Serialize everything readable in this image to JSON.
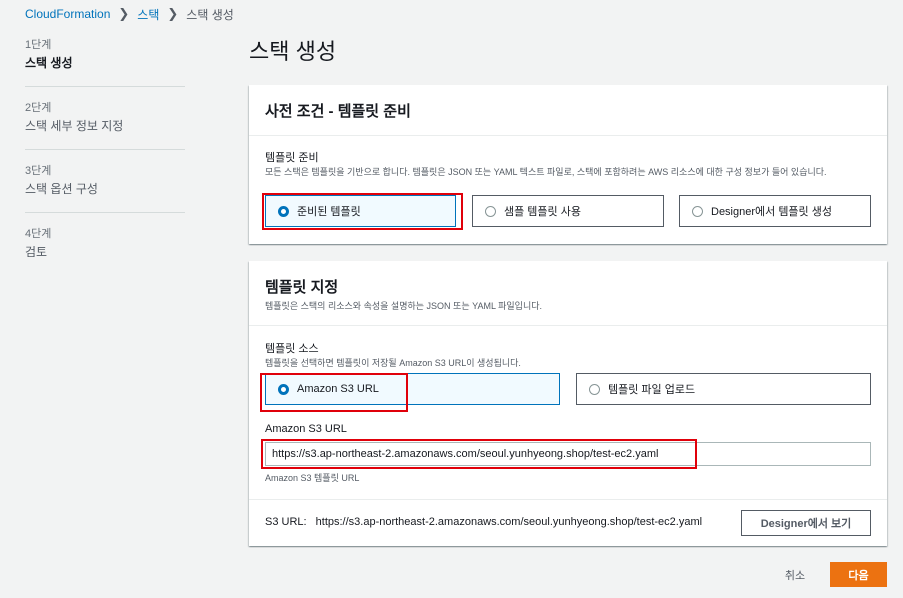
{
  "breadcrumb": {
    "items": [
      "CloudFormation",
      "스택"
    ],
    "current": "스택 생성"
  },
  "steps": [
    {
      "num": "1단계",
      "label": "스택 생성"
    },
    {
      "num": "2단계",
      "label": "스택 세부 정보 지정"
    },
    {
      "num": "3단계",
      "label": "스택 옵션 구성"
    },
    {
      "num": "4단계",
      "label": "검토"
    }
  ],
  "page_title": "스택 생성",
  "prereq": {
    "title": "사전 조건 - 템플릿 준비",
    "field_label": "템플릿 준비",
    "field_desc": "모든 스택은 템플릿을 기반으로 합니다. 템플릿은 JSON 또는 YAML 텍스트 파일로, 스택에 포함하려는 AWS 리소스에 대한 구성 정보가 들어 있습니다.",
    "options": [
      "준비된 템플릿",
      "샘플 템플릿 사용",
      "Designer에서 템플릿 생성"
    ],
    "selected": "준비된 템플릿"
  },
  "template_spec": {
    "title": "템플릿 지정",
    "desc": "템플릿은 스택의 리소스와 속성을 설명하는 JSON 또는 YAML 파일입니다.",
    "source_label": "템플릿 소스",
    "source_desc": "템플릿을 선택하면 템플릿이 저장될 Amazon S3 URL이 생성됩니다.",
    "sources": [
      "Amazon S3 URL",
      "템플릿 파일 업로드"
    ],
    "selected_source": "Amazon S3 URL",
    "url_label": "Amazon S3 URL",
    "url_value": "https://s3.ap-northeast-2.amazonaws.com/seoul.yunhyeong.shop/test-ec2.yaml",
    "url_hint": "Amazon S3 템플릿 URL",
    "footer_label": "S3 URL:",
    "footer_value": "https://s3.ap-northeast-2.amazonaws.com/seoul.yunhyeong.shop/test-ec2.yaml",
    "designer_button": "Designer에서 보기"
  },
  "actions": {
    "cancel": "취소",
    "next": "다음"
  },
  "colors": {
    "accent": "#0073bb",
    "primary": "#ec7211",
    "highlight": "#e0000a"
  }
}
